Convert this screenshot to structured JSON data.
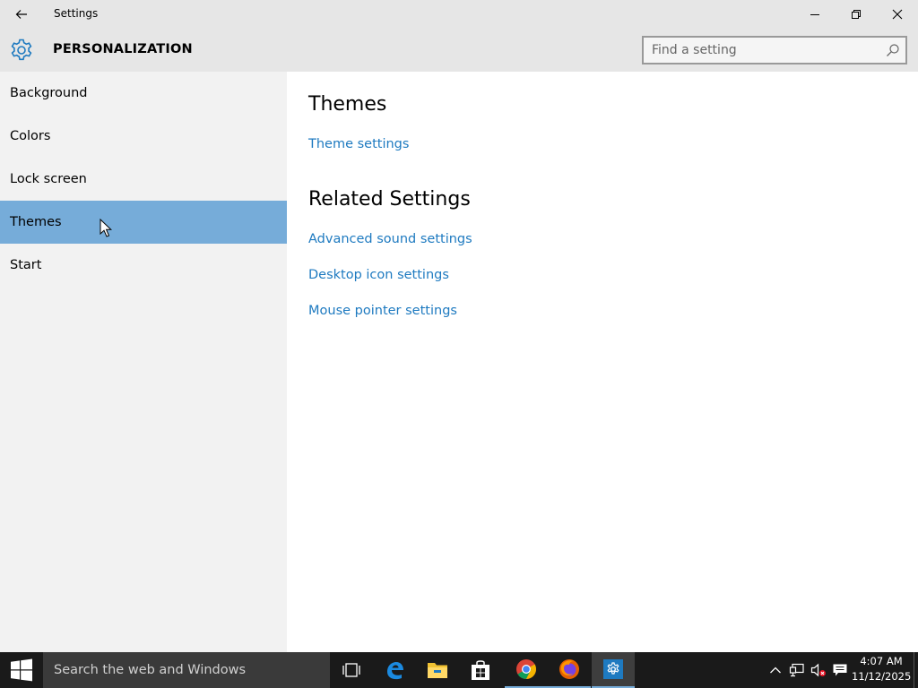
{
  "window": {
    "title": "Settings",
    "controls": [
      "minimize",
      "maximize",
      "close"
    ]
  },
  "header": {
    "section_title": "PERSONALIZATION",
    "search_placeholder": "Find a setting"
  },
  "sidebar": {
    "items": [
      {
        "label": "Background",
        "selected": false
      },
      {
        "label": "Colors",
        "selected": false
      },
      {
        "label": "Lock screen",
        "selected": false
      },
      {
        "label": "Themes",
        "selected": true
      },
      {
        "label": "Start",
        "selected": false
      }
    ]
  },
  "content": {
    "themes_heading": "Themes",
    "theme_settings_link": "Theme settings",
    "related_heading": "Related Settings",
    "related_links": [
      "Advanced sound settings",
      "Desktop icon settings",
      "Mouse pointer settings"
    ]
  },
  "taskbar": {
    "search_text": "Search the web and Windows",
    "pinned": [
      "task-view-icon",
      "edge-icon",
      "file-explorer-icon",
      "store-icon",
      "chrome-icon",
      "firefox-icon",
      "settings-icon"
    ],
    "active_app": "settings-icon",
    "tray": [
      "show-hidden-icons",
      "network-icon",
      "volume-muted-icon",
      "action-center-icon"
    ],
    "clock": {
      "time": "4:07 AM",
      "date": "11/12/2025"
    }
  },
  "colors": {
    "chrome_bg": "#e6e6e6",
    "sidebar_bg": "#f2f2f2",
    "selected_item": "#76acd9",
    "link": "#1e7ac0",
    "accent": "#1e7ac0",
    "taskbar": "#1a1a1a"
  }
}
